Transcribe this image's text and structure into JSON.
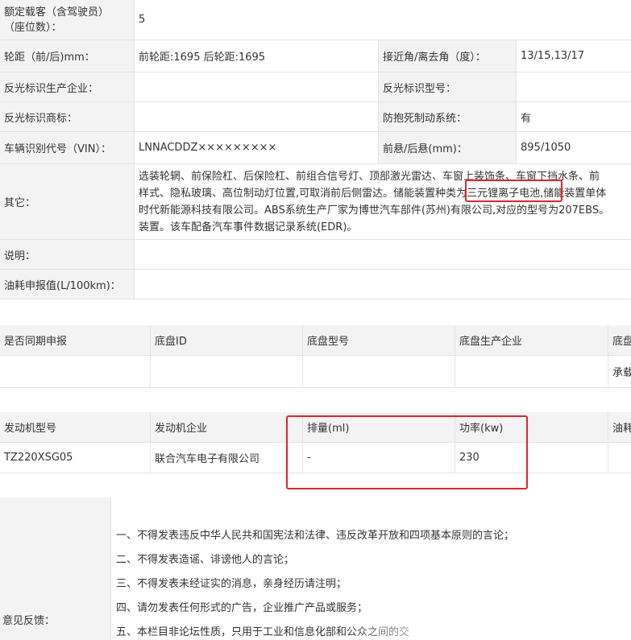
{
  "vehicle_table": {
    "rows": [
      {
        "label": "额定载客（含驾驶员）（座位数）：",
        "label_line1": "额定载客（含驾驶员）",
        "label_line2": "（座位数）：",
        "value": "5"
      },
      {
        "label": "轮距（前/后)mm：",
        "value": "前轮距:1695 后轮距:1695",
        "label2": "接近角/离去角（度）：",
        "value2": "13/15,13/17"
      },
      {
        "label": "反光标识生产企业：",
        "value": "",
        "label2": "反光标识型号：",
        "value2": ""
      },
      {
        "label": "反光标识商标：",
        "value": "",
        "label2": "防抱死制动系统：",
        "value2": "有"
      },
      {
        "label": "车辆识别代号（VIN）：",
        "value": "LNNACDDZ×××××××××",
        "label2": "前悬/后悬(mm)：",
        "value2": "895/1050"
      },
      {
        "label": "其它：",
        "value_lines": [
          "选装轮辋、前保险杠、后保险杠、前组合信号灯、顶部激光雷达、车窗上装饰条、车窗下挡水条、前",
          "样式、隐私玻璃、高位制动灯位置,可取消前后侧雷达。储能装置种类为三元锂离子电池,储能装置单体",
          "时代新能源科技有限公司。ABS系统生产厂家为博世汽车部件(苏州)有限公司,对应的型号为207EBS。",
          "装置。该车配备汽车事件数据记录系统(EDR)。"
        ]
      },
      {
        "label": "说明：",
        "value": ""
      },
      {
        "label": "油耗申报值(L/100km)：",
        "value": ""
      }
    ]
  },
  "chassis_table": {
    "headers": [
      "是否同期申报",
      "底盘ID",
      "底盘型号",
      "底盘生产企业",
      "底盘"
    ],
    "row": [
      "",
      "",
      "",
      "",
      "承载"
    ]
  },
  "engine_table": {
    "headers": [
      "发动机型号",
      "发动机企业",
      "排量(ml)",
      "功率(kw)",
      "油耗"
    ],
    "row": [
      "TZ220XSG05",
      "联合汽车电子有限公司",
      "-",
      "230",
      ""
    ]
  },
  "feedback": {
    "label": "意见反馈：",
    "notices": [
      "一、不得发表违反中华人民共和国宪法和法律、违反改革开放和四项基本原则的言论；",
      "二、不得发表造谣、诽谤他人的言论；",
      "三、不得发表未经证实的消息，亲身经历请注明；",
      "四、请勿发表任何形式的广告，企业推广产品或服务；",
      "五、本栏目非论坛性质，只用于工业和信息化部和公众之间的交"
    ]
  },
  "colors": {
    "annotation_red": "#e0252d",
    "label_bg": "#f3f3f3",
    "border": "#e4e4e4"
  }
}
